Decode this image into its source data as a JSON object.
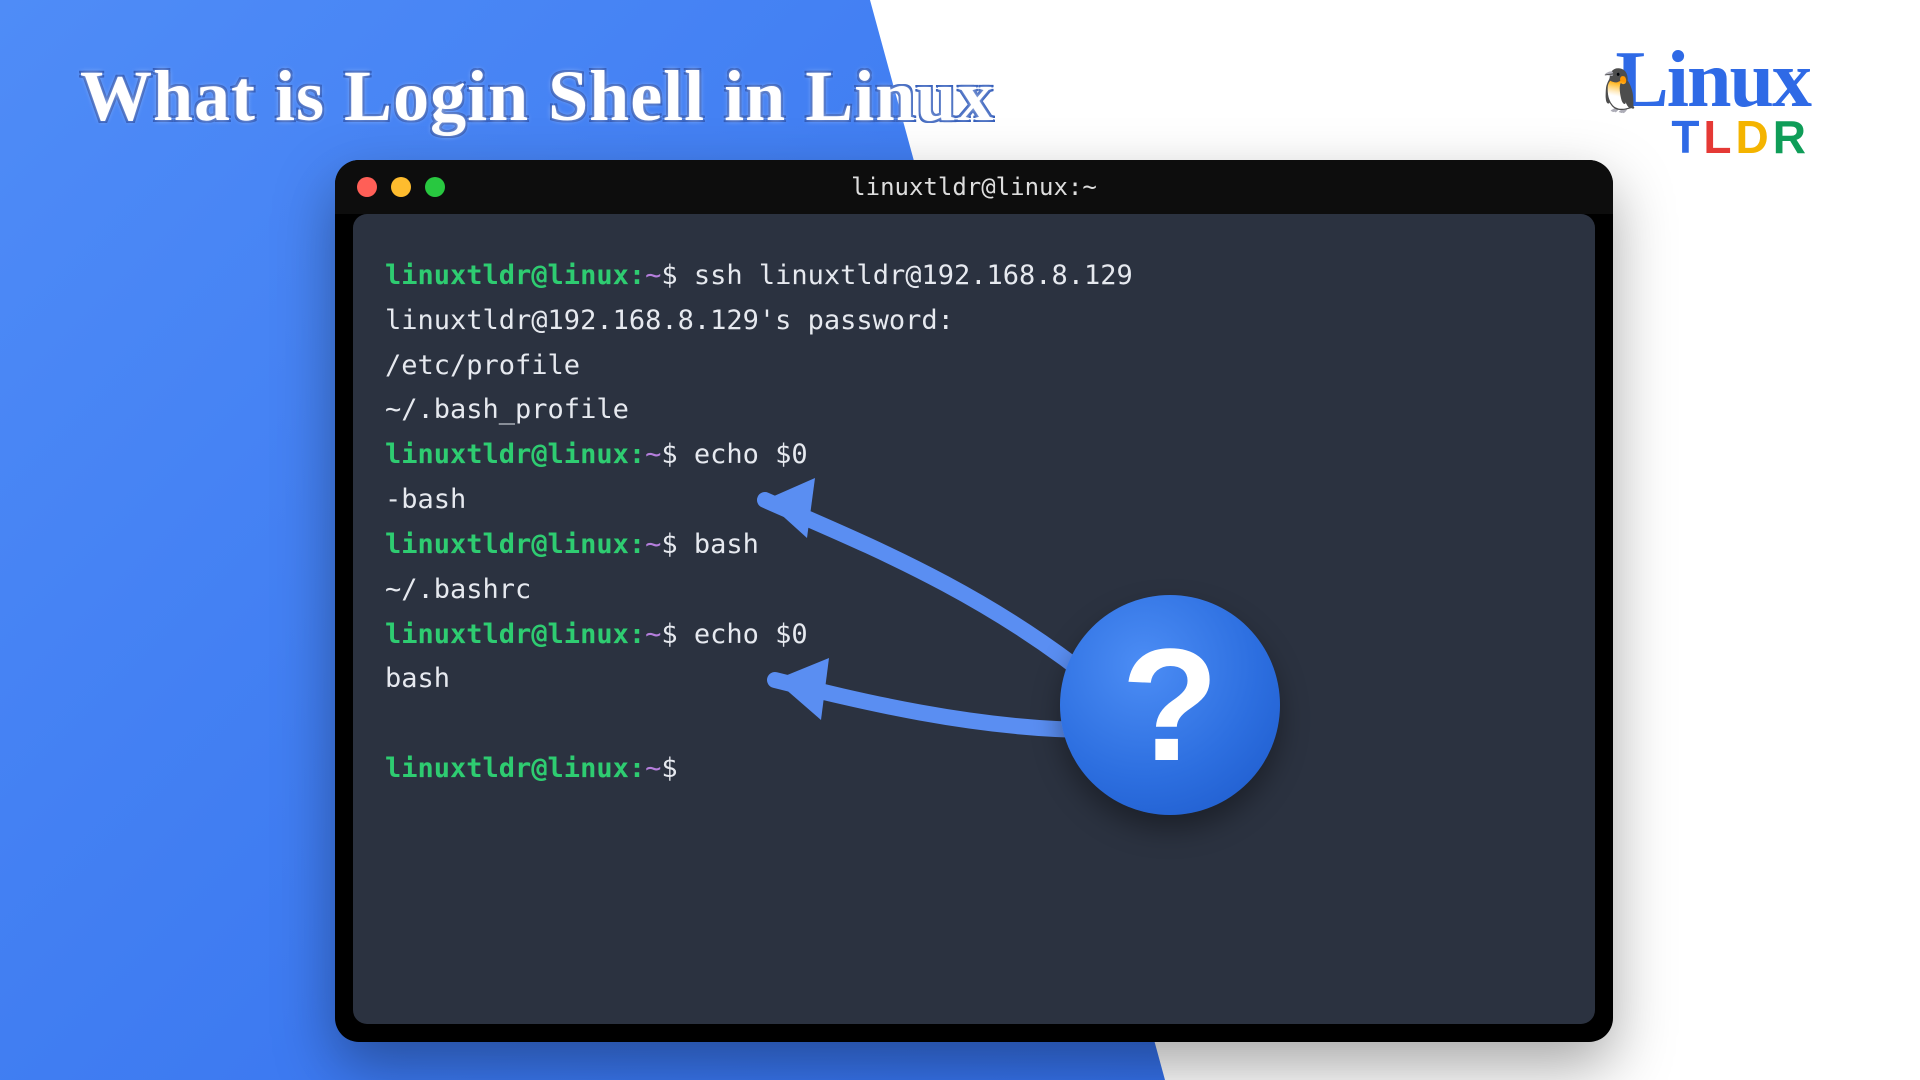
{
  "heading": "What is Login Shell in Linux",
  "logo": {
    "linux": "Linux",
    "t": "T",
    "l": "L",
    "d": "D",
    "r": "R"
  },
  "terminal": {
    "title": "linuxtldr@linux:~",
    "prompt_host": "linuxtldr@linux:",
    "prompt_path": "~",
    "prompt_dollar": "$",
    "lines": {
      "l0_cmd": " ssh linuxtldr@192.168.8.129",
      "l1": "linuxtldr@192.168.8.129's password:",
      "l2": "/etc/profile",
      "l3": "~/.bash_profile",
      "l4_cmd": " echo $0",
      "l5": "-bash",
      "l6_cmd": " bash",
      "l7": "~/.bashrc",
      "l8_cmd": " echo $0",
      "l9": "bash"
    }
  },
  "badge": {
    "glyph": "?"
  }
}
